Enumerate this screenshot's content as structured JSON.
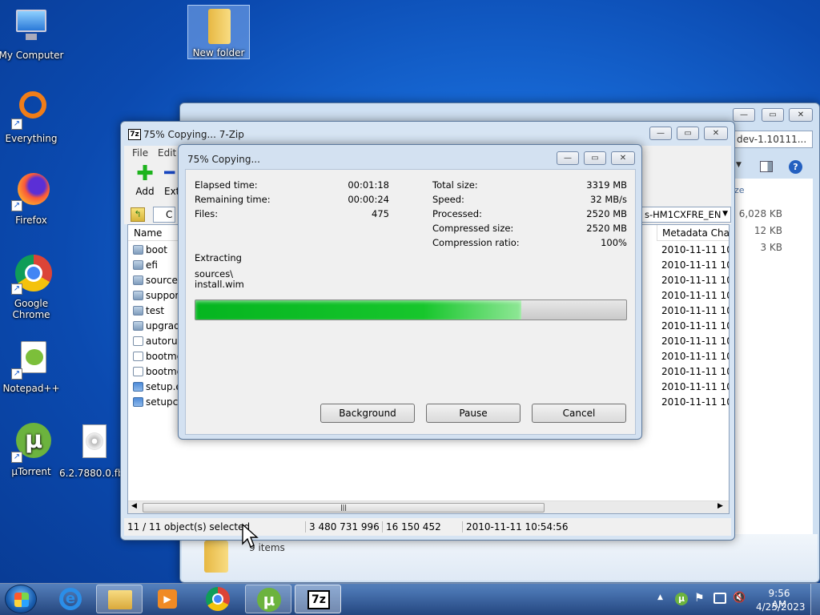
{
  "desktop": {
    "icons": [
      {
        "label": "My Computer"
      },
      {
        "label": "Everything"
      },
      {
        "label": "Firefox"
      },
      {
        "label": "Google Chrome"
      },
      {
        "label": "Notepad++"
      },
      {
        "label": "µTorrent"
      },
      {
        "label": "6.2.7880.0.fb..."
      },
      {
        "label": "New folder"
      }
    ]
  },
  "bg_window": {
    "address": "dev-1.10111...",
    "address_full": "s-HM1CXFRE_EN",
    "size_col": "ze",
    "sizes": [
      "6,028 KB",
      "12 KB",
      "3 KB"
    ],
    "meta_col": "Metadata Cha...",
    "items": "9 items"
  },
  "zip": {
    "title": "75% Copying... 7-Zip",
    "menu": [
      "File",
      "Edit"
    ],
    "toolbar": {
      "add": "Add",
      "extract": "Extr"
    },
    "path": "C",
    "col_name": "Name",
    "files": [
      {
        "name": "boot",
        "type": "folder",
        "date": "2010-11-11 10:5"
      },
      {
        "name": "efi",
        "type": "folder",
        "date": "2010-11-11 10:5"
      },
      {
        "name": "sources",
        "type": "folder",
        "date": "2010-11-11 10:5"
      },
      {
        "name": "support",
        "type": "folder",
        "date": "2010-11-11 10:5"
      },
      {
        "name": "test",
        "type": "folder",
        "date": "2010-11-11 10:5"
      },
      {
        "name": "upgrade",
        "type": "folder",
        "date": "2010-11-11 10:5"
      },
      {
        "name": "autorun",
        "type": "inf",
        "date": "2010-11-11 10:5"
      },
      {
        "name": "bootmg",
        "type": "doc",
        "date": "2010-11-11 10:5"
      },
      {
        "name": "bootmg",
        "type": "doc",
        "date": "2010-11-11 10:5"
      },
      {
        "name": "setup.ex",
        "type": "exe",
        "date": "2010-11-11 10:5"
      },
      {
        "name": "setupcl",
        "type": "exe",
        "date": "2010-11-11 10:5"
      }
    ],
    "status": {
      "selected": "11 / 11 object(s) selected",
      "size": "3 480 731 996",
      "packed": "16 150 452",
      "modified": "2010-11-11 10:54:56"
    }
  },
  "progress": {
    "title": "75% Copying...",
    "left": [
      {
        "label": "Elapsed time:",
        "value": "00:01:18"
      },
      {
        "label": "Remaining time:",
        "value": "00:00:24"
      },
      {
        "label": "Files:",
        "value": "475"
      }
    ],
    "right": [
      {
        "label": "Total size:",
        "value": "3319 MB"
      },
      {
        "label": "Speed:",
        "value": "32 MB/s"
      },
      {
        "label": "Processed:",
        "value": "2520 MB"
      },
      {
        "label": "Compressed size:",
        "value": "2520 MB"
      },
      {
        "label": "Compression ratio:",
        "value": "100%"
      }
    ],
    "action": "Extracting",
    "path1": "sources\\",
    "path2": "install.wim",
    "fraction": 0.757,
    "buttons": {
      "background": "Background",
      "pause": "Pause",
      "cancel": "Cancel"
    }
  },
  "taskbar": {
    "time": "9:56 AM",
    "date": "4/25/2023",
    "zip_label": "7z"
  }
}
